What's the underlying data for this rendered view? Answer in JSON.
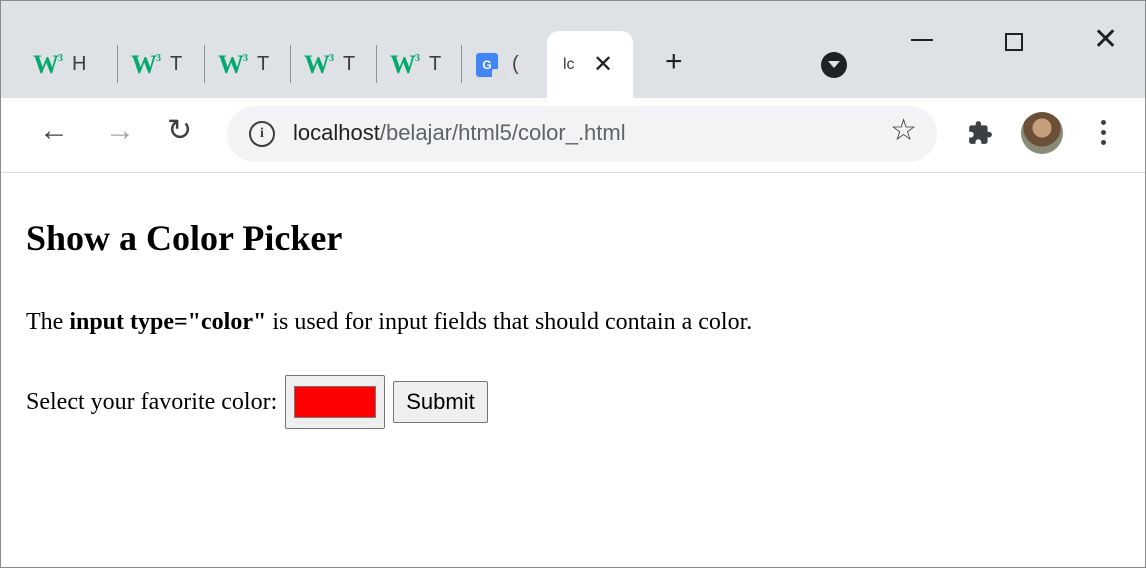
{
  "tabs": [
    {
      "favicon": "w3schools-icon",
      "title": "H"
    },
    {
      "favicon": "w3schools-icon",
      "title": "T"
    },
    {
      "favicon": "w3schools-icon",
      "title": "T"
    },
    {
      "favicon": "w3schools-icon",
      "title": "T"
    },
    {
      "favicon": "w3schools-icon",
      "title": "T"
    },
    {
      "favicon": "google-translate-icon",
      "title": "("
    }
  ],
  "active_tab": {
    "title": "lc",
    "close": "✕"
  },
  "window_controls": {
    "minimize": "minimize-icon",
    "maximize": "maximize-icon",
    "close": "✕"
  },
  "toolbar": {
    "url_host": "localhost",
    "url_path": "/belajar/html5/color_.html"
  },
  "page": {
    "heading": "Show a Color Picker",
    "desc_prefix": "The ",
    "desc_bold": "input type=\"color\"",
    "desc_suffix": " is used for input fields that should contain a color.",
    "label": "Select your favorite color:",
    "color_value": "#ff0000",
    "submit_label": "Submit"
  }
}
